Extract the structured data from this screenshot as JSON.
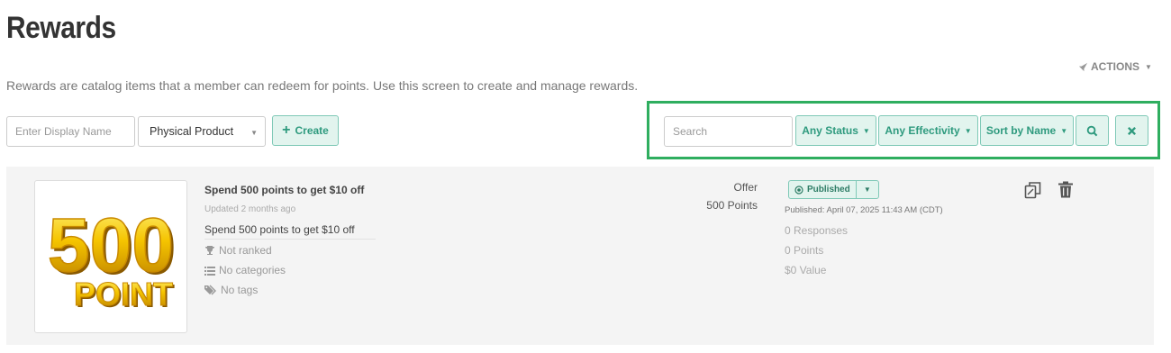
{
  "page": {
    "title": "Rewards",
    "subtitle": "Rewards are catalog items that a member can redeem for points. Use this screen to create and manage rewards.",
    "actions_label": "ACTIONS"
  },
  "create_bar": {
    "display_name_placeholder": "Enter Display Name",
    "type_select": "Physical Product",
    "create_label": "Create"
  },
  "filters": {
    "search_placeholder": "Search",
    "status": "Any Status",
    "effectivity": "Any Effectivity",
    "sort": "Sort by Name"
  },
  "colors": {
    "accent": "#2e9a7e",
    "accent_bg": "#e2f4ee",
    "highlight": "#2fae5f"
  },
  "reward": {
    "image_text_top": "500",
    "image_text_bottom": "POINT",
    "title": "Spend 500 points to get $10 off",
    "updated": "Updated 2 months ago",
    "description": "Spend 500 points to get $10 off",
    "rank": "Not ranked",
    "categories": "No categories",
    "tags": "No tags",
    "type": "Offer",
    "points": "500 Points",
    "status": "Published",
    "published_at": "Published: April 07, 2025 11:43 AM (CDT)",
    "responses": "0 Responses",
    "points_stat": "0 Points",
    "value": "$0 Value"
  }
}
